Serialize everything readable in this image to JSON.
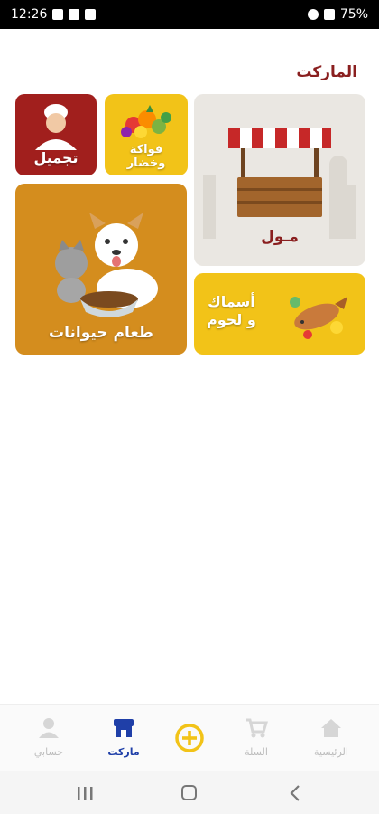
{
  "status": {
    "time": "12:26",
    "battery": "75%"
  },
  "page_title": "الماركت",
  "tiles": {
    "mall": "مـول",
    "fruits": "فواكة\nوخضار",
    "beauty": "تجميل",
    "fish_line1": "أسماك",
    "fish_line2": "و لحوم",
    "pets": "طعام حيوانات"
  },
  "nav": {
    "home": "الرئيسية",
    "cart": "السلة",
    "market": "ماركت",
    "account": "حسابي"
  },
  "colors": {
    "maroon": "#8a1f1f",
    "yellow": "#f2c318",
    "orange": "#d48d1e",
    "active_blue": "#1f3fa8"
  },
  "icons": [
    "home-icon",
    "cart-icon",
    "add-icon",
    "market-icon",
    "user-icon"
  ]
}
